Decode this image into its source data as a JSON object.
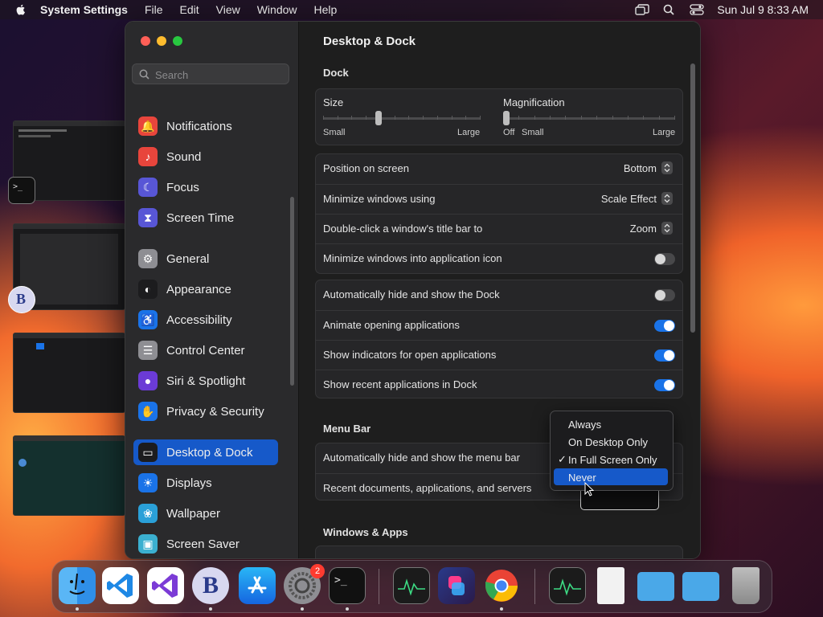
{
  "menubar": {
    "app": "System Settings",
    "items": [
      "File",
      "Edit",
      "View",
      "Window",
      "Help"
    ],
    "datetime": "Sun Jul 9  8:33 AM"
  },
  "window": {
    "title": "Desktop & Dock"
  },
  "sidebar": {
    "search_placeholder": "Search",
    "items": [
      {
        "label": "Notifications",
        "icon": "bell-icon",
        "color": "#e8453c"
      },
      {
        "label": "Sound",
        "icon": "speaker-icon",
        "color": "#e8453c"
      },
      {
        "label": "Focus",
        "icon": "moon-icon",
        "color": "#5856d6"
      },
      {
        "label": "Screen Time",
        "icon": "hourglass-icon",
        "color": "#5856d6"
      },
      {
        "label": "General",
        "icon": "gear-icon",
        "color": "#8e8e93"
      },
      {
        "label": "Appearance",
        "icon": "appearance-icon",
        "color": "#1c1c1e"
      },
      {
        "label": "Accessibility",
        "icon": "accessibility-icon",
        "color": "#1a73e8"
      },
      {
        "label": "Control Center",
        "icon": "control-center-icon",
        "color": "#8e8e93"
      },
      {
        "label": "Siri & Spotlight",
        "icon": "siri-icon",
        "color": "#6b3bd6"
      },
      {
        "label": "Privacy & Security",
        "icon": "hand-icon",
        "color": "#1a73e8"
      },
      {
        "label": "Desktop & Dock",
        "icon": "dock-icon",
        "color": "#1c1c1e"
      },
      {
        "label": "Displays",
        "icon": "sun-icon",
        "color": "#1a73e8"
      },
      {
        "label": "Wallpaper",
        "icon": "wallpaper-icon",
        "color": "#2aa0d8"
      },
      {
        "label": "Screen Saver",
        "icon": "screensaver-icon",
        "color": "#3bb0d0"
      }
    ],
    "active": "Desktop & Dock"
  },
  "dock_section": {
    "title": "Dock",
    "size": {
      "label": "Size",
      "min": "Small",
      "max": "Large",
      "value": 0.35
    },
    "magnification": {
      "label": "Magnification",
      "off": "Off",
      "min": "Small",
      "max": "Large",
      "value": 0.0
    },
    "rows": [
      {
        "label": "Position on screen",
        "value": "Bottom"
      },
      {
        "label": "Minimize windows using",
        "value": "Scale Effect"
      },
      {
        "label": "Double-click a window's title bar to",
        "value": "Zoom"
      },
      {
        "label": "Minimize windows into application icon",
        "toggle": false
      }
    ],
    "toggles": [
      {
        "label": "Automatically hide and show the Dock",
        "on": false
      },
      {
        "label": "Animate opening applications",
        "on": true
      },
      {
        "label": "Show indicators for open applications",
        "on": true
      },
      {
        "label": "Show recent applications in Dock",
        "on": true
      }
    ]
  },
  "menubar_section": {
    "title": "Menu Bar",
    "rows": [
      {
        "label": "Automatically hide and show the menu bar"
      },
      {
        "label": "Recent documents, applications, and servers"
      }
    ]
  },
  "windows_section": {
    "title": "Windows & Apps"
  },
  "popup": {
    "options": [
      "Always",
      "On Desktop Only",
      "In Full Screen Only",
      "Never"
    ],
    "checked": "In Full Screen Only",
    "highlighted": "Never",
    "checkmark": "✓"
  },
  "dock": {
    "apps": [
      "finder-icon",
      "vscode-icon",
      "visual-studio-icon",
      "bbedit-icon",
      "app-store-icon",
      "system-settings-icon",
      "terminal-icon",
      "activity-monitor-icon",
      "shortcuts-icon",
      "chrome-icon",
      "activity-monitor-doc-icon",
      "document-icon",
      "downloads-folder-icon",
      "folder-icon",
      "trash-icon"
    ],
    "settings_badge": "2"
  }
}
